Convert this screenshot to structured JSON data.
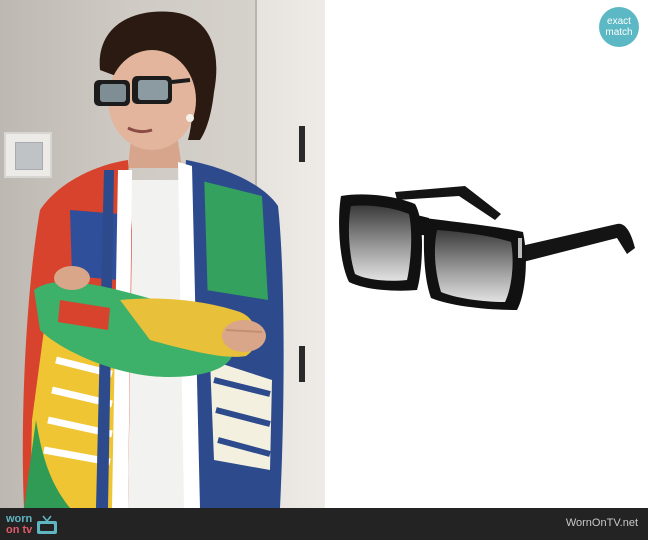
{
  "badge": {
    "line1": "exact",
    "line2": "match",
    "color": "#5bb8c4"
  },
  "footer": {
    "logo_worn": "worn",
    "logo_ontv": "on tv",
    "site": "WornOnTV.net",
    "background": "#232323"
  },
  "photo": {
    "subject": "woman in oversized printed silk shirt and black square sunglasses"
  },
  "product": {
    "item": "black square sunglasses with gradient lenses"
  },
  "icons": [
    "tv-icon",
    "sunglasses-image"
  ]
}
